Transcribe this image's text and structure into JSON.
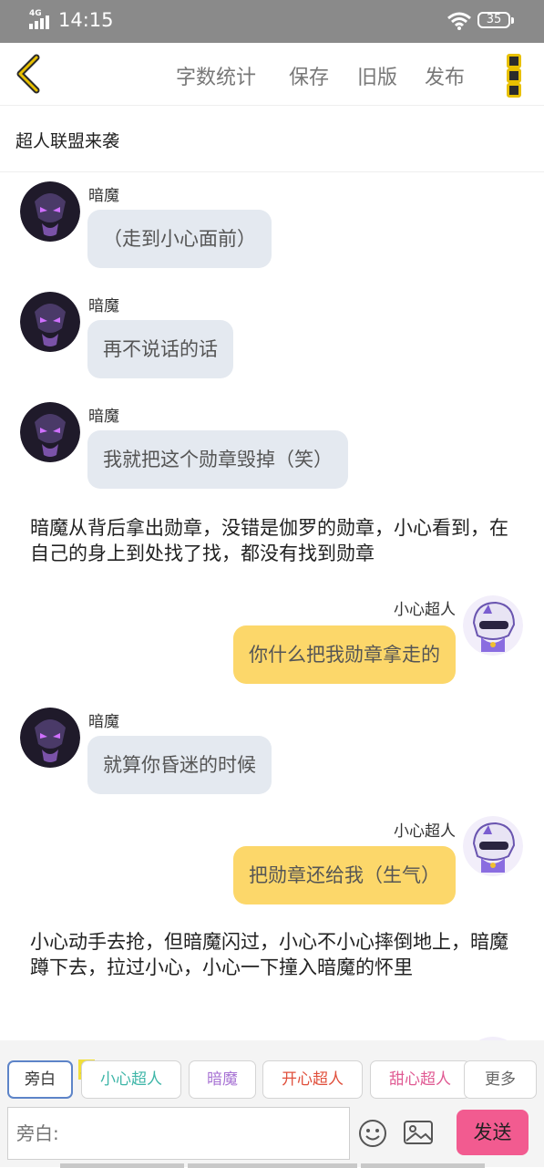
{
  "status_bar": {
    "network": "4G",
    "time": "14:15",
    "battery": "35"
  },
  "toolbar": {
    "word_count": "字数统计",
    "save": "保存",
    "old_version": "旧版",
    "publish": "发布"
  },
  "story": {
    "title": "超人联盟来袭"
  },
  "messages": [
    {
      "type": "left",
      "name": "暗魔",
      "text": "（走到小心面前）"
    },
    {
      "type": "left",
      "name": "暗魔",
      "text": "再不说话的话"
    },
    {
      "type": "left",
      "name": "暗魔",
      "text": "我就把这个勋章毁掉（笑）"
    },
    {
      "type": "narration",
      "text": "暗魔从背后拿出勋章，没错是伽罗的勋章，小心看到，在自己的身上到处找了找，都没有找到勋章"
    },
    {
      "type": "right",
      "name": "小心超人",
      "text": "你什么把我勋章拿走的"
    },
    {
      "type": "left",
      "name": "暗魔",
      "text": "就算你昏迷的时候"
    },
    {
      "type": "right",
      "name": "小心超人",
      "text": "把勋章还给我（生气）"
    },
    {
      "type": "narration",
      "text": "小心动手去抢，但暗魔闪过，小心不小心摔倒地上，暗魔蹲下去，拉过小心，小心一下撞入暗魔的怀里"
    }
  ],
  "roles": {
    "items": [
      "旁白",
      "小心超人",
      "暗魔",
      "开心超人",
      "甜心超人"
    ],
    "colors": [
      "#888888",
      "#3fb6a8",
      "#a874d4",
      "#e0503c",
      "#e05a93"
    ],
    "host_tag": "主",
    "more": "更多"
  },
  "input": {
    "placeholder": "旁白:"
  },
  "send": {
    "label": "发送"
  },
  "colors": {
    "status_bar": "#8a8a8a",
    "left_bubble": "#e4e9f0",
    "right_bubble": "#fcd76a",
    "send_button": "#f25b90",
    "icon_yellow": "#e8c000"
  }
}
